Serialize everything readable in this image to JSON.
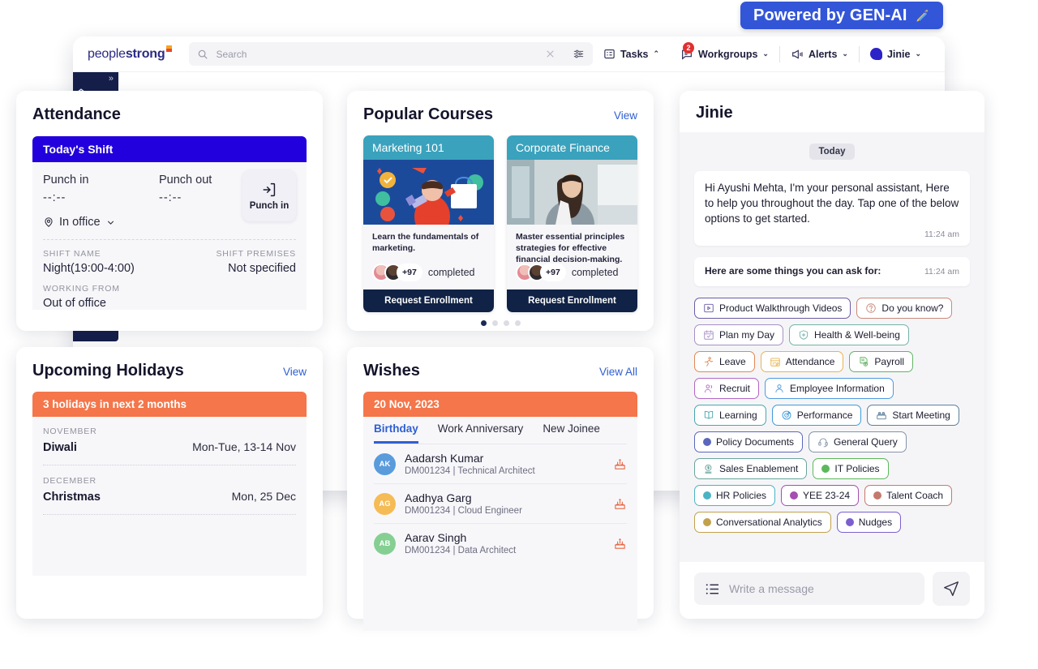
{
  "banner": {
    "text": "Powered by GEN-AI",
    "icon": "magic-pen-icon",
    "color": "#3355D8"
  },
  "topbar": {
    "logo_light": "people",
    "logo_bold": "strong",
    "search_placeholder": "Search",
    "items": [
      {
        "label": "Tasks",
        "icon": "tasks-icon",
        "chevron": "⌃"
      },
      {
        "label": "Workgroups",
        "icon": "workgroups-icon",
        "badge": "2",
        "chevron": "⌄"
      },
      {
        "label": "Alerts",
        "icon": "megaphone-icon",
        "chevron": "⌄"
      },
      {
        "label": "Jinie",
        "icon": "jinie-logo-icon",
        "chevron": "⌄"
      }
    ]
  },
  "rail": {
    "expand": "»",
    "home_icon": "home-icon",
    "chart_icon": "bar-chart-icon"
  },
  "attendance": {
    "title": "Attendance",
    "shift_banner": "Today's Shift",
    "punch_in_label": "Punch in",
    "punch_in_value": "--:--",
    "punch_out_label": "Punch out",
    "punch_out_value": "--:--",
    "punch_button": "Punch in",
    "location": "In office",
    "shift_name_label": "SHIFT NAME",
    "shift_name_value": "Night(19:00-4:00)",
    "shift_premises_label": "SHIFT PREMISES",
    "shift_premises_value": "Not specified",
    "working_from_label": "WORKING FROM",
    "working_from_value": "Out of office"
  },
  "courses": {
    "title": "Popular  Courses",
    "view_label": "View",
    "items": [
      {
        "name": "Marketing 101",
        "desc": "Learn the fundamentals of marketing.",
        "count": "+97",
        "completed": "completed",
        "cta": "Request Enrollment"
      },
      {
        "name": "Corporate Finance",
        "desc": "Master essential principles strategies for effective financial decision-making.",
        "count": "+97",
        "completed": "completed",
        "cta": "Request Enrollment"
      }
    ],
    "carousel_dots": 4,
    "active_dot": 0
  },
  "holidays": {
    "title": "Upcoming Holidays",
    "view_label": "View",
    "summary": "3 holidays in next 2 months",
    "items": [
      {
        "month": "NOVEMBER",
        "name": "Diwali",
        "date": "Mon-Tue, 13-14 Nov"
      },
      {
        "month": "DECEMBER",
        "name": "Christmas",
        "date": "Mon, 25 Dec"
      }
    ]
  },
  "wishes": {
    "title": "Wishes",
    "view_all_label": "View All",
    "date": "20 Nov, 2023",
    "tabs": [
      "Birthday",
      "Work Anniversary",
      "New Joinee"
    ],
    "active_tab": 0,
    "items": [
      {
        "initials": "AK",
        "color": "#5a9bdc",
        "name": "Aadarsh Kumar",
        "sub": "DM001234 | Technical Architect",
        "icon": "birthday-cake-icon"
      },
      {
        "initials": "AG",
        "color": "#f5bb55",
        "name": "Aadhya Garg",
        "sub": "DM001234 | Cloud Engineer",
        "icon": "birthday-cake-icon"
      },
      {
        "initials": "AB",
        "color": "#85cf92",
        "name": "Aarav Singh",
        "sub": "DM001234 | Data Architect",
        "icon": "birthday-cake-icon"
      }
    ]
  },
  "jinie": {
    "title": "Jinie",
    "day_divider": "Today",
    "greeting": "Hi Ayushi Mehta, I'm your personal assistant, Here to help you throughout the day. Tap one of the below options to get started.",
    "greeting_time": "11:24 am",
    "prompt": "Here are some things you can ask for:",
    "prompt_time": "11:24 am",
    "chips": [
      {
        "label": "Product Walkthrough Videos",
        "color": "#6b5ca5",
        "icon": "play-box-icon",
        "style": "icon"
      },
      {
        "label": "Do you know?",
        "color": "#c98a7a",
        "icon": "question-circle-icon",
        "style": "icon"
      },
      {
        "label": "Plan my Day",
        "color": "#a88fc4",
        "icon": "calendar-check-icon",
        "style": "icon"
      },
      {
        "label": "Health & Well-being",
        "color": "#74b2a8",
        "icon": "shield-plus-icon",
        "style": "icon"
      },
      {
        "label": "Leave",
        "color": "#e08855",
        "icon": "leave-walk-icon",
        "style": "icon"
      },
      {
        "label": "Attendance",
        "color": "#e8b451",
        "icon": "attendance-calendar-icon",
        "style": "icon"
      },
      {
        "label": "Payroll",
        "color": "#63b463",
        "icon": "payroll-doc-icon",
        "style": "icon"
      },
      {
        "label": "Recruit",
        "color": "#b266c4",
        "icon": "recruit-people-icon",
        "style": "icon"
      },
      {
        "label": "Employee Information",
        "color": "#4f9ade",
        "icon": "person-icon",
        "style": "icon"
      },
      {
        "label": "Learning",
        "color": "#4aa6ae",
        "icon": "book-open-icon",
        "style": "icon"
      },
      {
        "label": "Performance",
        "color": "#3f9ad6",
        "icon": "target-icon",
        "style": "icon"
      },
      {
        "label": "Start Meeting",
        "color": "#5d7f9c",
        "icon": "meeting-icon",
        "style": "icon"
      },
      {
        "label": "Policy Documents",
        "color": "#5b67bb",
        "icon": "dot",
        "style": "dot"
      },
      {
        "label": "General Query",
        "color": "#8494a8",
        "icon": "headset-icon",
        "style": "icon"
      },
      {
        "label": "Sales Enablement",
        "color": "#6aa59c",
        "icon": "sales-money-icon",
        "style": "icon"
      },
      {
        "label": "IT Policies",
        "color": "#5cb85c",
        "icon": "dot",
        "style": "dot"
      },
      {
        "label": "HR Policies",
        "color": "#4cb3c4",
        "icon": "dot",
        "style": "dot"
      },
      {
        "label": "YEE 23-24",
        "color": "#a54fb0",
        "icon": "dot",
        "style": "dot"
      },
      {
        "label": "Talent Coach",
        "color": "#c4796b",
        "icon": "dot",
        "style": "dot"
      },
      {
        "label": "Conversational Analytics",
        "color": "#c2a14d",
        "icon": "dot",
        "style": "dot"
      },
      {
        "label": "Nudges",
        "color": "#7b5fd0",
        "icon": "dot",
        "style": "dot"
      }
    ],
    "input_placeholder": "Write a message",
    "input_value": "",
    "menu_icon": "list-menu-icon",
    "send_icon": "send-icon"
  }
}
